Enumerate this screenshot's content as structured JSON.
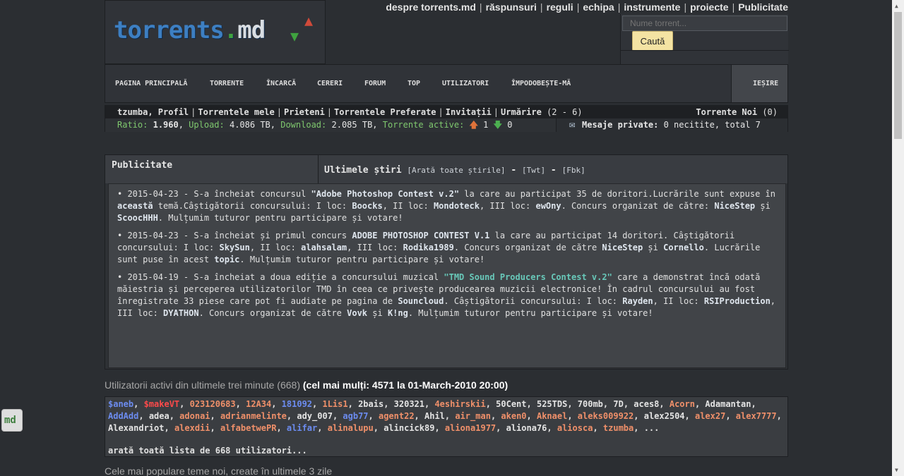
{
  "site": {
    "logo_main": "torrents",
    "logo_dot": ".",
    "logo_md": "md"
  },
  "topnav": [
    "despre torrents.md",
    "răspunsuri",
    "reguli",
    "echipa",
    "instrumente",
    "proiecte",
    "Publicitate"
  ],
  "topnav_sep": "|",
  "search": {
    "placeholder": "Nume torrent...",
    "button": "Caută"
  },
  "mainnav": [
    "PAGINA PRINCIPALĂ",
    "TORRENTE",
    "ÎNCARCĂ",
    "CERERI",
    "FORUM",
    "TOP",
    "UTILIZATORI",
    "ÎMPODOBEȘTE-MĂ"
  ],
  "logout": "IEȘIRE",
  "userbar": {
    "links": [
      "tzumba, Profil",
      "Torrentele mele",
      "Prieteni",
      "Torrentele Preferate",
      "Invitații",
      "Urmărire"
    ],
    "urmarire_count": "(2 - 6)",
    "new_torrents": "Torrente Noi",
    "new_torrents_count": "(0)",
    "sep": "|",
    "ratio_label": "Ratio:",
    "ratio": "1.960",
    "upload_label": "Upload:",
    "upload": "4.086 TB",
    "download_label": "Download:",
    "download": "2.085 TB",
    "active_label": "Torrente active:",
    "active_up": "1",
    "active_down": "0",
    "pm_label": "Mesaje private:",
    "pm_text": "0 necitite, total 7"
  },
  "content": {
    "pub_title": "Publicitate",
    "news_title": "Ultimele știri",
    "news_all": "[Arată toate știrile]",
    "news_twt": "[Twt]",
    "news_fbk": "[Fbk]",
    "news_dash": "-",
    "news": [
      {
        "p1": "• 2015-04-23 - S-a încheiat concursul ",
        "b1": "\"Adobe Photoshop Contest v.2\"",
        "p2": " la care au participat 35 de doritori.Lucrările sunt expuse în ",
        "b2": "această",
        "p3": " temă.Câștigătorii concursului: I loc: ",
        "b3": "Boocks",
        "p4": ", II loc: ",
        "b4": "Mondoteck",
        "p5": ", III loc: ",
        "b5": "ewOny",
        "p6": ". Concurs organizat de către: ",
        "b6": "NiceStep",
        "p7": " și ",
        "b7": "ScoocHHH",
        "p8": ". Mulțumim tuturor pentru participare și votare!"
      },
      {
        "p1": "• 2015-04-23 - S-a încheiat și primul concurs ",
        "b1": "ADOBE PHOTOSHOP CONTEST V.1",
        "p2": " la care au participat 14 doritori. Câștigătorii concursului: I loc: ",
        "b2": "SkySun",
        "p3": ", II loc: ",
        "b3": "alahsalam",
        "p4": ", III loc: ",
        "b4": "Rodika1989",
        "p5": ". Concurs organizat de către ",
        "b5": "NiceStep",
        "p6": " și ",
        "b6": "Cornello",
        "p7": ". Lucrările sunt puse în acest ",
        "b7": "topic",
        "p8": ". Mulțumim tuturor pentru participare și votare!"
      },
      {
        "p1": "• 2015-04-19 - S-a încheiat a doua ediție a concursului muzical ",
        "b1": "\"TMD Sound Producers Contest v.2\"",
        "p2": " care a demonstrat încă odată măiestria și perceperea utilizatorilor TMD în ceea ce privește producearea muzicii electronice! În cadrul concursului au fost înregistrate 33 piese care pot fi audiate pe pagina de ",
        "b2": "Souncloud",
        "p3": ". Câștigătorii concursului: I loc: ",
        "b3": "Rayden",
        "p4": ", II loc: ",
        "b4": "RSIProduction",
        "p5": ", III loc: ",
        "b5": "DYATHON",
        "p6": ". Concurs organizat de către ",
        "b6": "Vovk",
        "p7": " și ",
        "b7": "K!ng",
        "p8": ". Mulțumim tuturor pentru participare și votare!"
      }
    ]
  },
  "active_users": {
    "title": "Utilizatorii activi din ultimele trei minute (668)",
    "record": "(cel mai mulți: 4571 la 01-March-2010 20:00)",
    "users": [
      {
        "n": "$aneb",
        "c": "u-bl"
      },
      {
        "n": "$makeVT",
        "c": "u-rd"
      },
      {
        "n": "023120683",
        "c": "u-or"
      },
      {
        "n": "12A34",
        "c": "u-or"
      },
      {
        "n": "181092",
        "c": "u-bl"
      },
      {
        "n": "1Lis1",
        "c": "u-or"
      },
      {
        "n": "2bais",
        "c": "u-wh"
      },
      {
        "n": "320321",
        "c": "u-wh"
      },
      {
        "n": "4eshirskii",
        "c": "u-or"
      },
      {
        "n": "50Cent",
        "c": "u-wh"
      },
      {
        "n": "525TDS",
        "c": "u-wh"
      },
      {
        "n": "700mb",
        "c": "u-wh"
      },
      {
        "n": "7D",
        "c": "u-wh"
      },
      {
        "n": "aces8",
        "c": "u-wh"
      },
      {
        "n": "Acorn",
        "c": "u-or"
      },
      {
        "n": "Adamantan",
        "c": "u-wh"
      },
      {
        "n": "AddAdd",
        "c": "u-bl"
      },
      {
        "n": "adea",
        "c": "u-wh"
      },
      {
        "n": "adonai",
        "c": "u-or"
      },
      {
        "n": "adrianmelinte",
        "c": "u-or"
      },
      {
        "n": "ady_007",
        "c": "u-wh"
      },
      {
        "n": "agb77",
        "c": "u-bl"
      },
      {
        "n": "agent22",
        "c": "u-or"
      },
      {
        "n": "Ahil",
        "c": "u-wh"
      },
      {
        "n": "air_man",
        "c": "u-or"
      },
      {
        "n": "aken0",
        "c": "u-or"
      },
      {
        "n": "Aknael",
        "c": "u-or"
      },
      {
        "n": "aleks009922",
        "c": "u-or"
      },
      {
        "n": "alex2504",
        "c": "u-wh"
      },
      {
        "n": "alex27",
        "c": "u-or"
      },
      {
        "n": "alex7777",
        "c": "u-or"
      },
      {
        "n": "Alexandriot",
        "c": "u-wh"
      },
      {
        "n": "alexdii",
        "c": "u-or"
      },
      {
        "n": "alfabetwePR",
        "c": "u-or"
      },
      {
        "n": "alifar",
        "c": "u-bl"
      },
      {
        "n": "alinalupu",
        "c": "u-or"
      },
      {
        "n": "alincick89",
        "c": "u-wh"
      },
      {
        "n": "aliona1977",
        "c": "u-or"
      },
      {
        "n": "aliona76",
        "c": "u-wh"
      },
      {
        "n": "aliosca",
        "c": "u-or"
      },
      {
        "n": "tzumba",
        "c": "u-or"
      }
    ],
    "ellipsis": "...",
    "show_all": "arată toată lista de 668 utilizatori..."
  },
  "popular_title": "Cele mai populare teme noi, create în ultimele 3 zile",
  "widget_label": "md"
}
